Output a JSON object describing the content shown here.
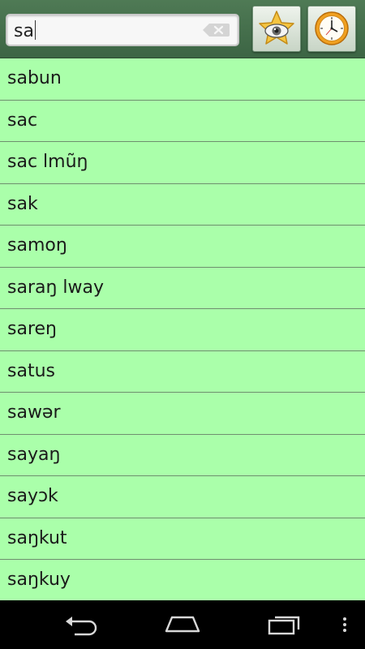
{
  "search": {
    "value": "sa"
  },
  "toolbar": {
    "favorites_icon": "star-eye-icon",
    "history_icon": "clock-icon"
  },
  "words": [
    "sabun",
    "sac",
    "sac lmũŋ",
    "sak",
    "samoŋ",
    "saraŋ lway",
    "sareŋ",
    "satus",
    "sawər",
    "sayaŋ",
    "sayɔk",
    "saŋkut",
    "saŋkuy"
  ],
  "colors": {
    "topbar": "#3c6544",
    "list_background": "#aaffaa",
    "divider": "#6f8f6f"
  },
  "navbar": {
    "icons": [
      "back-icon",
      "home-icon",
      "recent-apps-icon",
      "menu-icon"
    ]
  }
}
